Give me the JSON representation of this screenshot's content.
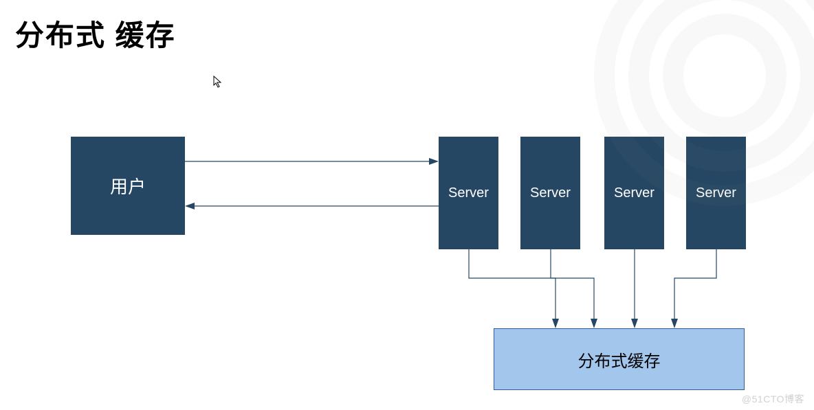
{
  "title": "分布式 缓存",
  "user_label": "用户",
  "servers": {
    "s1": "Server",
    "s2": "Server",
    "s3": "Server",
    "s4": "Server"
  },
  "cache_label": "分布式缓存",
  "watermark": "@51CTO博客",
  "colors": {
    "boxDark": "#264763",
    "cacheFill": "#a2c6ec",
    "cacheBorder": "#2d5e96"
  }
}
